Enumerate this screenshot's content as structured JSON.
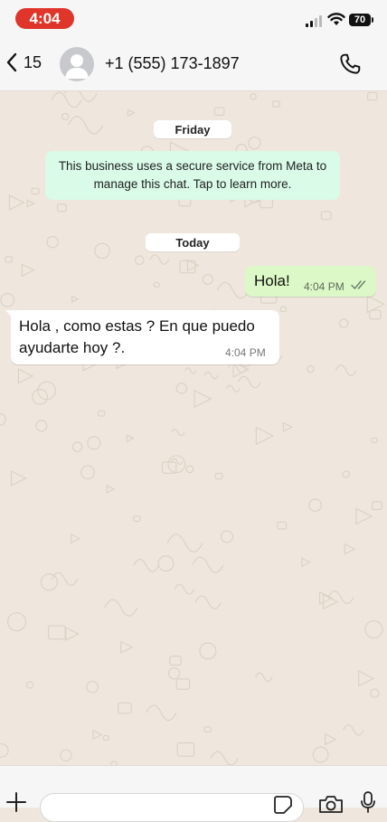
{
  "status_bar": {
    "time": "4:04",
    "battery": "70"
  },
  "header": {
    "back_count": "15",
    "contact_name": "+1 (555) 173-1897"
  },
  "chat": {
    "date_friday": "Friday",
    "notice": "This business uses a secure service from Meta to manage this chat. Tap to learn more.",
    "date_today": "Today",
    "messages": [
      {
        "direction": "outgoing",
        "text": "Hola!",
        "time": "4:04 PM",
        "status": "read"
      },
      {
        "direction": "incoming",
        "text": "Hola , como estas ? En que puedo ayudarte hoy ?.",
        "time": "4:04 PM"
      }
    ]
  },
  "colors": {
    "time_pill": "#e0352b",
    "chat_background": "#efe7dd",
    "outgoing_bubble": "#dcf8c6",
    "notice_bubble": "#d9fbe8",
    "read_ticks": "#6b7b6b"
  },
  "icons": [
    "chevron-left-icon",
    "avatar-placeholder-icon",
    "phone-icon",
    "double-check-icon",
    "plus-icon",
    "sticker-icon",
    "camera-icon",
    "microphone-icon"
  ]
}
